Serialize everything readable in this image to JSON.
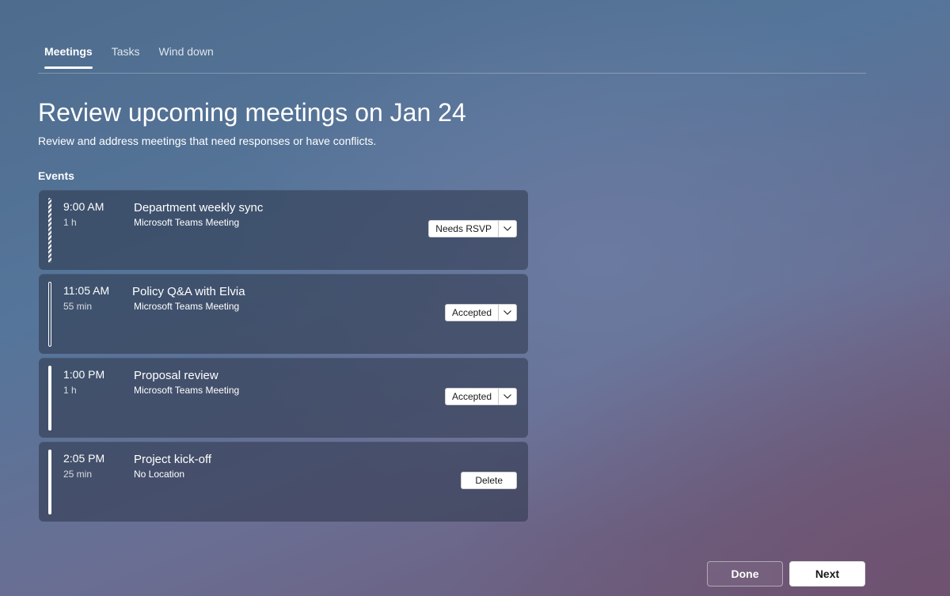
{
  "tabs": [
    {
      "label": "Meetings",
      "active": true
    },
    {
      "label": "Tasks",
      "active": false
    },
    {
      "label": "Wind down",
      "active": false
    }
  ],
  "page": {
    "title": "Review upcoming meetings on Jan 24",
    "subtitle": "Review and address meetings that need responses or have conflicts.",
    "events_heading": "Events"
  },
  "events": [
    {
      "time": "9:00 AM",
      "duration": "1 h",
      "title": "Department weekly sync",
      "location": "Microsoft Teams Meeting",
      "action": "Needs RSVP",
      "status_style": "tentative"
    },
    {
      "time": "11:05 AM",
      "duration": "55 min",
      "title": "Policy Q&A with Elvia",
      "location": "Microsoft Teams Meeting",
      "action": "Accepted",
      "status_style": "outline"
    },
    {
      "time": "1:00 PM",
      "duration": "1 h",
      "title": "Proposal review",
      "location": "Microsoft Teams Meeting",
      "action": "Accepted",
      "status_style": "solid"
    },
    {
      "time": "2:05 PM",
      "duration": "25 min",
      "title": "Project kick-off",
      "location": "No Location",
      "action": "Delete",
      "status_style": "solid"
    }
  ],
  "footer": {
    "done_label": "Done",
    "next_label": "Next"
  },
  "icons": {
    "dropdown": "chevron-down-icon"
  }
}
